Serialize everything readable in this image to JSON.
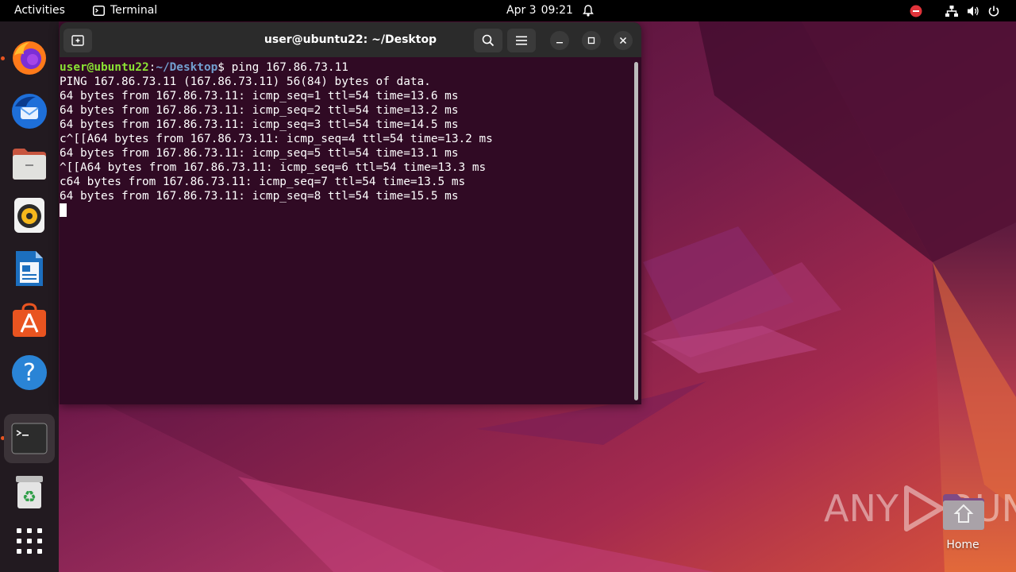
{
  "topbar": {
    "activities": "Activities",
    "app_name": "Terminal",
    "date": "Apr 3",
    "time": "09:21"
  },
  "dock": {
    "items": [
      {
        "name": "firefox",
        "running": true
      },
      {
        "name": "thunderbird",
        "running": false
      },
      {
        "name": "files",
        "running": false
      },
      {
        "name": "rhythmbox",
        "running": false
      },
      {
        "name": "libreoffice-writer",
        "running": false
      },
      {
        "name": "app-center",
        "running": false
      },
      {
        "name": "help",
        "running": false
      },
      {
        "name": "terminal",
        "running": true,
        "active": true
      },
      {
        "name": "trash",
        "running": false
      },
      {
        "name": "show-apps",
        "running": false
      }
    ]
  },
  "terminal": {
    "title": "user@ubuntu22: ~/Desktop",
    "prompt_user": "user@ubuntu22",
    "prompt_sep": ":",
    "prompt_path": "~/Desktop",
    "prompt_end": "$ ",
    "command": "ping 167.86.73.11",
    "output": [
      "PING 167.86.73.11 (167.86.73.11) 56(84) bytes of data.",
      "64 bytes from 167.86.73.11: icmp_seq=1 ttl=54 time=13.6 ms",
      "64 bytes from 167.86.73.11: icmp_seq=2 ttl=54 time=13.2 ms",
      "64 bytes from 167.86.73.11: icmp_seq=3 ttl=54 time=14.5 ms",
      "c^[[A64 bytes from 167.86.73.11: icmp_seq=4 ttl=54 time=13.2 ms",
      "64 bytes from 167.86.73.11: icmp_seq=5 ttl=54 time=13.1 ms",
      "^[[A64 bytes from 167.86.73.11: icmp_seq=6 ttl=54 time=13.3 ms",
      "c64 bytes from 167.86.73.11: icmp_seq=7 ttl=54 time=13.5 ms",
      "64 bytes from 167.86.73.11: icmp_seq=8 ttl=54 time=15.5 ms"
    ]
  },
  "desktop": {
    "home_label": "Home",
    "watermark_left": "ANY",
    "watermark_right": "RUN"
  },
  "colors": {
    "terminal_bg": "#300a24",
    "prompt_user": "#8ae234",
    "prompt_path": "#729fcf",
    "accent": "#e95420"
  }
}
